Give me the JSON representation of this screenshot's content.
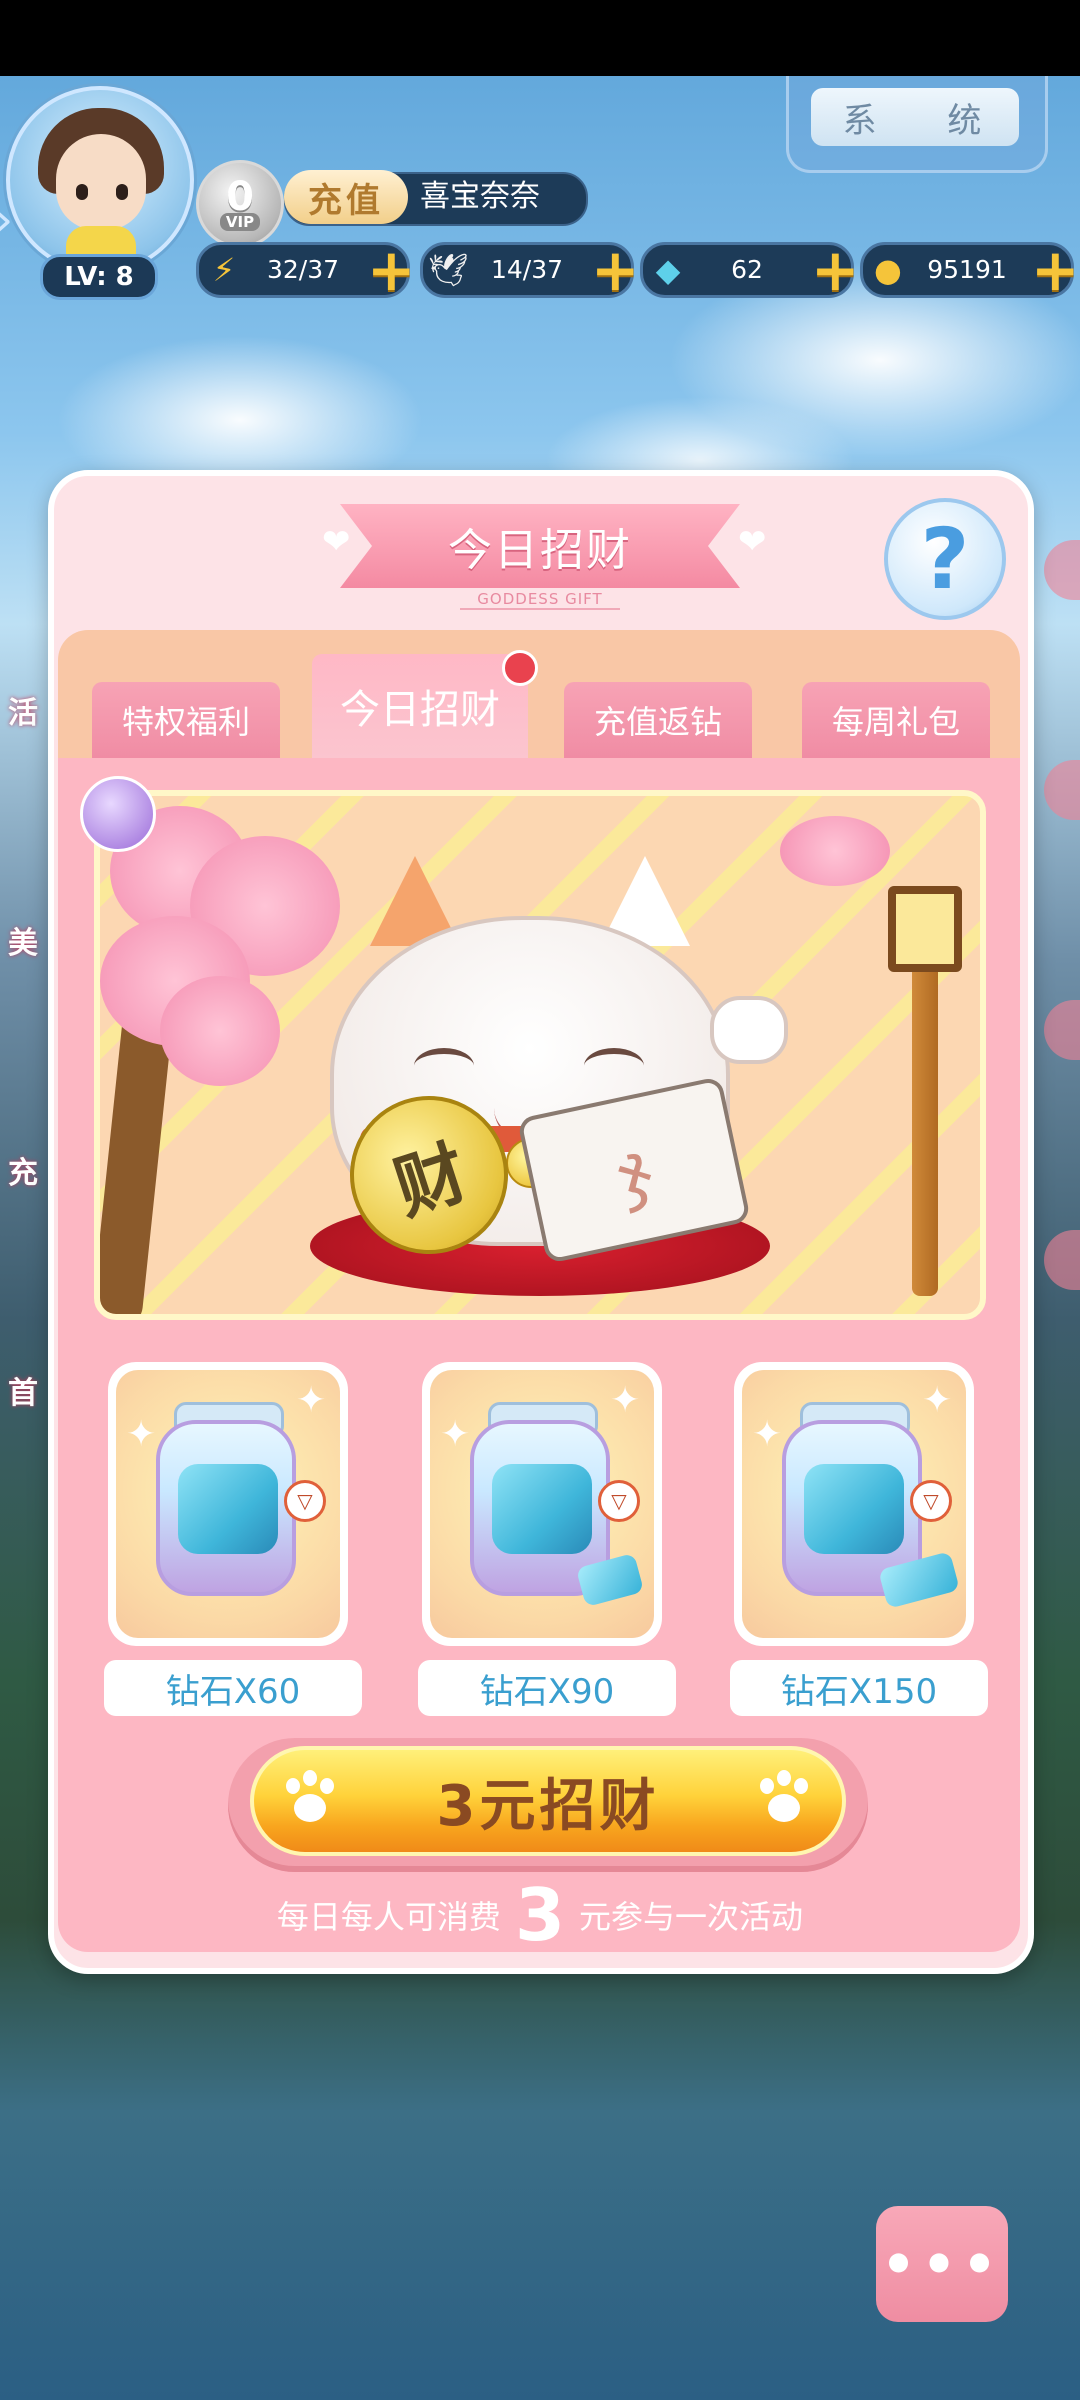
{
  "header": {
    "level": "LV: 8",
    "vip": {
      "number": "0",
      "label": "VIP"
    },
    "recharge_label": "充值",
    "player_name": "喜宝奈奈",
    "system_label": "系  统"
  },
  "resources": [
    {
      "icon": "lightning-icon",
      "value": "32/37"
    },
    {
      "icon": "wing-icon",
      "value": "14/37"
    },
    {
      "icon": "diamond-icon",
      "value": "62"
    },
    {
      "icon": "coin-icon",
      "value": "95191"
    }
  ],
  "side_left": [
    "活",
    "美",
    "充",
    "首"
  ],
  "popup": {
    "title": "今日招财",
    "subtitle": "GODDESS GIFT",
    "help_label": "?",
    "tabs": [
      {
        "label": "特权福利",
        "active": false
      },
      {
        "label": "今日招财",
        "active": true,
        "dot": true
      },
      {
        "label": "充值返钻",
        "active": false
      },
      {
        "label": "每周礼包",
        "active": false
      }
    ],
    "scene": {
      "coin_text": "财",
      "fan_text": "ჯ"
    },
    "rewards": [
      {
        "label": "钻石X60"
      },
      {
        "label": "钻石X90"
      },
      {
        "label": "钻石X150"
      }
    ],
    "buy_button": "3元招财",
    "note": {
      "prefix": "每日每人可消费",
      "amount": "3",
      "suffix": "元参与一次活动"
    }
  },
  "more_button": "•••",
  "colors": {
    "popup_bg": "#fde3e7",
    "content_bg": "#fdb7c3",
    "tab_strip": "#f9c7a6",
    "buy_button": "#f8a51e",
    "accent_blue": "#3a9fcf"
  }
}
